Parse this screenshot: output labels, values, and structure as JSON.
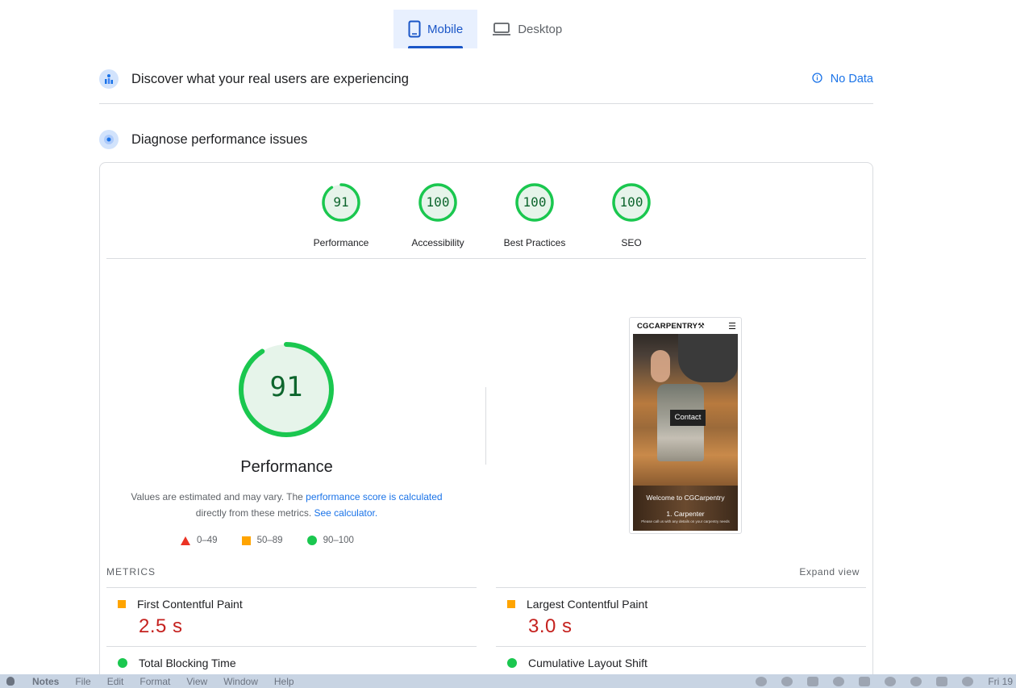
{
  "device_tabs": [
    {
      "label": "Mobile",
      "active": true
    },
    {
      "label": "Desktop",
      "active": false
    }
  ],
  "field_data": {
    "title": "Discover what your real users are experiencing",
    "status": "No Data"
  },
  "lab": {
    "title": "Diagnose performance issues"
  },
  "categories": [
    {
      "label": "Performance",
      "score": "91",
      "value": 0.91
    },
    {
      "label": "Accessibility",
      "score": "100",
      "value": 1.0
    },
    {
      "label": "Best Practices",
      "score": "100",
      "value": 1.0
    },
    {
      "label": "SEO",
      "score": "100",
      "value": 1.0
    }
  ],
  "performance": {
    "score": "91",
    "value": 0.91,
    "title": "Performance",
    "desc_prefix": "Values are estimated and may vary. The ",
    "desc_link1": "performance score is calculated",
    "desc_middle": "directly from these metrics. ",
    "desc_link2": "See calculator."
  },
  "legend": [
    {
      "range": "0–49"
    },
    {
      "range": "50–89"
    },
    {
      "range": "90–100"
    }
  ],
  "preview": {
    "brand": "CGCARPENTRY",
    "brand_glyph": "⚒",
    "menu_glyph": "☰",
    "contact": "Contact",
    "welcome": "Welcome to CGCarpentry",
    "item": "1. Carpenter",
    "tiny": "Please call us with any details on your carpentry needs"
  },
  "metrics": {
    "heading": "METRICS",
    "expand": "Expand view",
    "items": [
      {
        "name": "First Contentful Paint",
        "value": "2.5 s",
        "rating": "average"
      },
      {
        "name": "Largest Contentful Paint",
        "value": "3.0 s",
        "rating": "average"
      },
      {
        "name": "Total Blocking Time",
        "value": "",
        "rating": "pass"
      },
      {
        "name": "Cumulative Layout Shift",
        "value": "",
        "rating": "pass"
      }
    ]
  },
  "menubar": {
    "app": "Notes",
    "items": [
      "File",
      "Edit",
      "Format",
      "View",
      "Window",
      "Help"
    ],
    "clock": "Fri 19"
  },
  "colors": {
    "pass": "#1ac74f",
    "average": "#ffa400",
    "fail": "#eb3324",
    "accent": "#1a73e8"
  }
}
